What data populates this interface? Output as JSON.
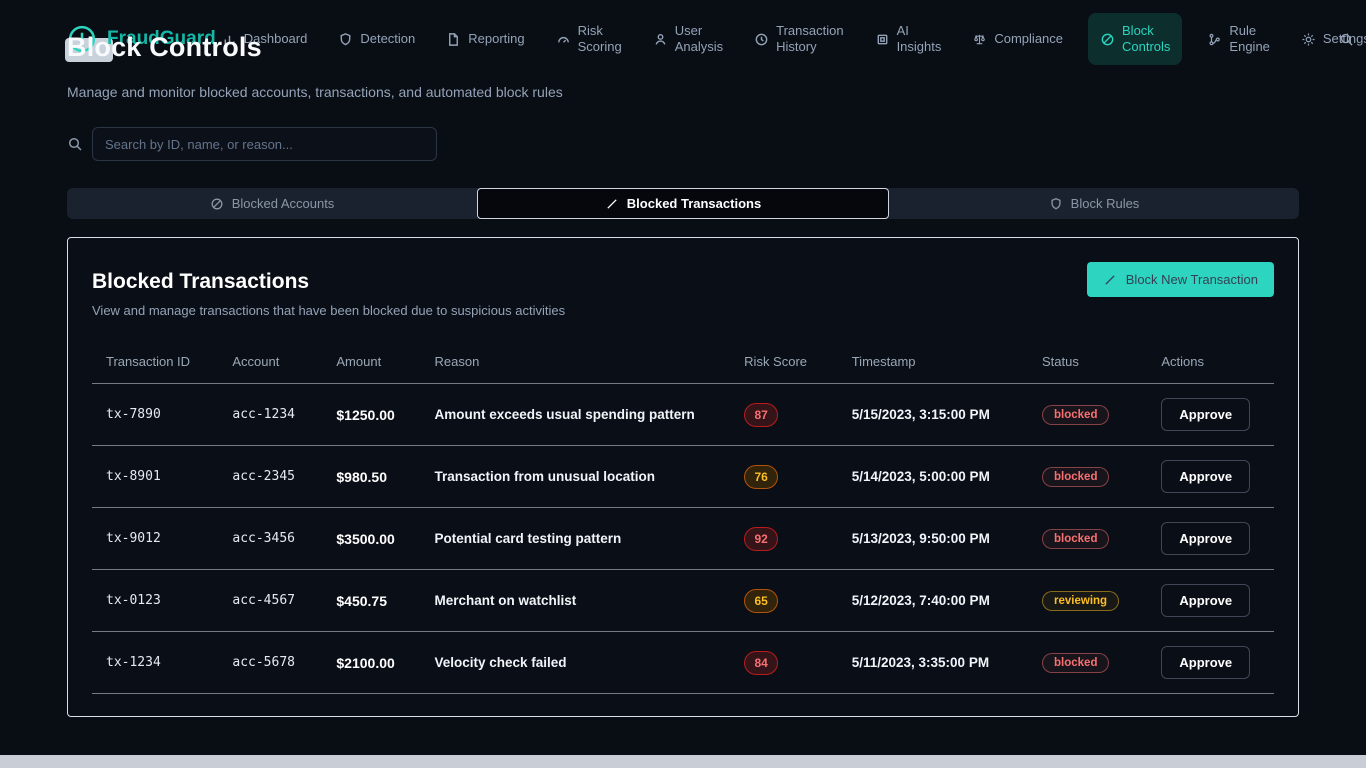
{
  "brand": {
    "name": "FraudGuard",
    "logo_icon": "alert-circle-icon",
    "accent_color": "#2dd4bf"
  },
  "nav": {
    "items": [
      {
        "label": "Dashboard",
        "icon": "bar-chart-icon",
        "active": false
      },
      {
        "label": "Detection",
        "icon": "shield-icon",
        "active": false
      },
      {
        "label": "Reporting",
        "icon": "document-icon",
        "active": false
      },
      {
        "label": "Risk Scoring",
        "icon": "gauge-icon",
        "active": false
      },
      {
        "label": "User Analysis",
        "icon": "user-icon",
        "active": false
      },
      {
        "label": "Transaction History",
        "icon": "history-icon",
        "active": false
      },
      {
        "label": "AI Insights",
        "icon": "chip-icon",
        "active": false
      },
      {
        "label": "Compliance",
        "icon": "scale-icon",
        "active": false
      },
      {
        "label": "Block Controls",
        "icon": "ban-icon",
        "active": true
      },
      {
        "label": "Rule Engine",
        "icon": "branch-icon",
        "active": false
      },
      {
        "label": "Settings",
        "icon": "gear-icon",
        "active": false
      }
    ],
    "right_icon": "search-icon"
  },
  "page": {
    "title": "Block Controls",
    "subtitle": "Manage and monitor blocked accounts, transactions, and automated block rules"
  },
  "search": {
    "placeholder": "Search by ID, name, or reason...",
    "icon": "search-icon"
  },
  "tabs": [
    {
      "label": "Blocked Accounts",
      "icon": "ban-icon",
      "active": false
    },
    {
      "label": "Blocked Transactions",
      "icon": "slash-icon",
      "active": true
    },
    {
      "label": "Block Rules",
      "icon": "shield-icon",
      "active": false
    }
  ],
  "panel": {
    "title": "Blocked Transactions",
    "subtitle": "View and manage transactions that have been blocked due to suspicious activities",
    "action_button": "Block New Transaction",
    "action_icon": "slash-icon"
  },
  "table": {
    "headers": [
      "Transaction ID",
      "Account",
      "Amount",
      "Reason",
      "Risk Score",
      "Timestamp",
      "Status",
      "Actions"
    ],
    "rows": [
      {
        "id": "tx-7890",
        "account": "acc-1234",
        "amount": "$1250.00",
        "reason": "Amount exceeds usual spending pattern",
        "risk_score": "87",
        "risk_level": "high",
        "timestamp": "5/15/2023, 3:15:00 PM",
        "status": "blocked",
        "action": "Approve"
      },
      {
        "id": "tx-8901",
        "account": "acc-2345",
        "amount": "$980.50",
        "reason": "Transaction from unusual location",
        "risk_score": "76",
        "risk_level": "medium",
        "timestamp": "5/14/2023, 5:00:00 PM",
        "status": "blocked",
        "action": "Approve"
      },
      {
        "id": "tx-9012",
        "account": "acc-3456",
        "amount": "$3500.00",
        "reason": "Potential card testing pattern",
        "risk_score": "92",
        "risk_level": "high",
        "timestamp": "5/13/2023, 9:50:00 PM",
        "status": "blocked",
        "action": "Approve"
      },
      {
        "id": "tx-0123",
        "account": "acc-4567",
        "amount": "$450.75",
        "reason": "Merchant on watchlist",
        "risk_score": "65",
        "risk_level": "medium",
        "timestamp": "5/12/2023, 7:40:00 PM",
        "status": "reviewing",
        "action": "Approve"
      },
      {
        "id": "tx-1234",
        "account": "acc-5678",
        "amount": "$2100.00",
        "reason": "Velocity check failed",
        "risk_score": "84",
        "risk_level": "high",
        "timestamp": "5/11/2023, 3:35:00 PM",
        "status": "blocked",
        "action": "Approve"
      }
    ]
  },
  "colors": {
    "accent": "#2dd4bf",
    "danger": "#f87171",
    "warning": "#fbbf24"
  }
}
